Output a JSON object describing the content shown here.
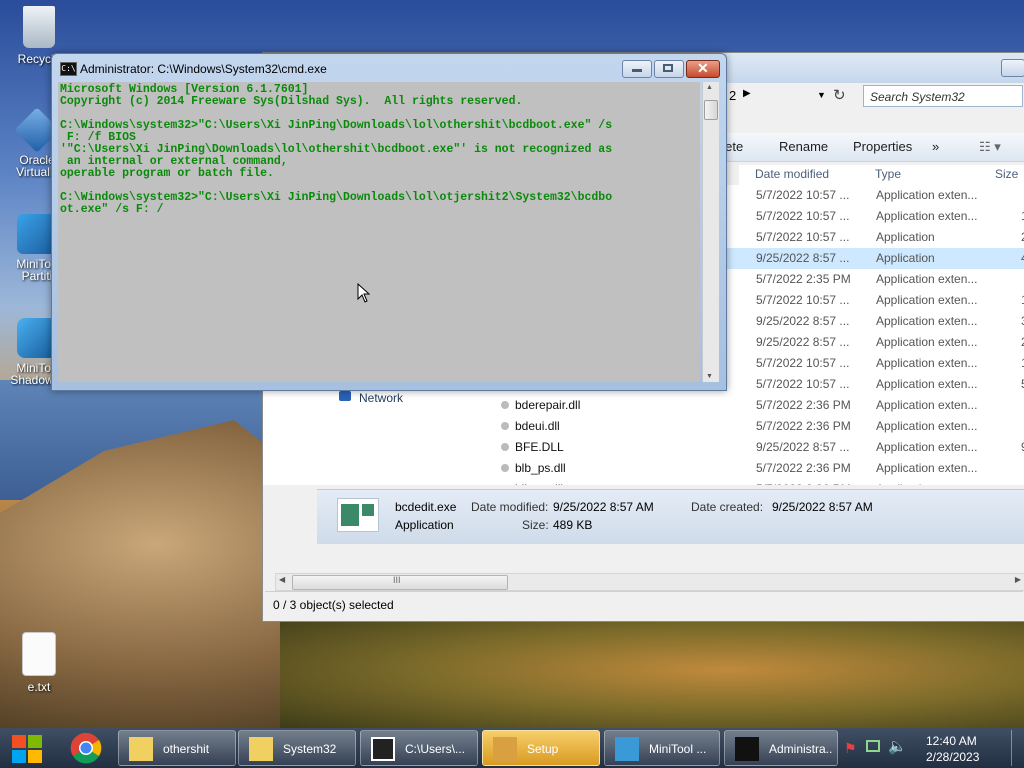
{
  "desktop": {
    "icons": [
      {
        "label": "Recycle",
        "id": "recycle"
      },
      {
        "label": "Oracle\nVirtualE",
        "id": "virtualbox"
      },
      {
        "label": "MiniToo\nPartiti",
        "id": "minitool-partition"
      },
      {
        "label": "MiniToo\nShadowM",
        "id": "minitool-shadowmaker"
      },
      {
        "label": "e.txt",
        "id": "etxt"
      }
    ]
  },
  "explorer": {
    "address_num": "2",
    "search_placeholder": "Search System32",
    "toolbar": {
      "delete": "elete",
      "rename": "Rename",
      "properties": "Properties",
      "more": "»"
    },
    "columns": {
      "date": "Date modified",
      "type": "Type",
      "size": "Size"
    },
    "nav_network": "Network",
    "files": [
      {
        "name": "",
        "date": "5/7/2022 10:57 ...",
        "type": "Application exten...",
        "size": "",
        "selected": false
      },
      {
        "name": "",
        "date": "5/7/2022 10:57 ...",
        "type": "Application exten...",
        "size": "1",
        "selected": false
      },
      {
        "name": "",
        "date": "5/7/2022 10:57 ...",
        "type": "Application",
        "size": "2",
        "selected": false
      },
      {
        "name": "",
        "date": "9/25/2022 8:57 ...",
        "type": "Application",
        "size": "4",
        "selected": true
      },
      {
        "name": "",
        "date": "5/7/2022 2:35 PM",
        "type": "Application exten...",
        "size": "",
        "selected": false
      },
      {
        "name": "",
        "date": "5/7/2022 10:57 ...",
        "type": "Application exten...",
        "size": "1",
        "selected": false
      },
      {
        "name": "",
        "date": "9/25/2022 8:57 ...",
        "type": "Application exten...",
        "size": "3",
        "selected": false
      },
      {
        "name": "",
        "date": "9/25/2022 8:57 ...",
        "type": "Application exten...",
        "size": "2",
        "selected": false
      },
      {
        "name": "",
        "date": "5/7/2022 10:57 ...",
        "type": "Application exten...",
        "size": "1",
        "selected": false
      },
      {
        "name": "",
        "date": "5/7/2022 10:57 ...",
        "type": "Application exten...",
        "size": "5",
        "selected": false
      },
      {
        "name": "bderepair.dll",
        "date": "5/7/2022 2:36 PM",
        "type": "Application exten...",
        "size": "",
        "selected": false
      },
      {
        "name": "bdeui.dll",
        "date": "5/7/2022 2:36 PM",
        "type": "Application exten...",
        "size": "",
        "selected": false
      },
      {
        "name": "BFE.DLL",
        "date": "9/25/2022 8:57 ...",
        "type": "Application exten...",
        "size": "9",
        "selected": false
      },
      {
        "name": "blb_ps.dll",
        "date": "5/7/2022 2:36 PM",
        "type": "Application exten...",
        "size": "",
        "selected": false
      },
      {
        "name": "blbres.dll",
        "date": "5/7/2022 2:36 PM",
        "type": "Application exten...",
        "size": "",
        "selected": false
      }
    ],
    "details": {
      "filename": "bcdedit.exe",
      "date_modified_label": "Date modified:",
      "date_modified": "9/25/2022 8:57 AM",
      "date_created_label": "Date created:",
      "date_created": "9/25/2022 8:57 AM",
      "type": "Application",
      "size_label": "Size:",
      "size": "489 KB"
    },
    "scroll_glyph": "III",
    "status": "0 / 3 object(s) selected"
  },
  "cmd": {
    "title": "Administrator: C:\\Windows\\System32\\cmd.exe",
    "icon_text": "C:\\",
    "lines": [
      "Microsoft Windows [Version 6.1.7601]",
      "Copyright (c) 2014 Freeware Sys(Dilshad Sys).  All rights reserved.",
      "",
      "C:\\Windows\\system32>\"C:\\Users\\Xi JinPing\\Downloads\\lol\\othershit\\bcdboot.exe\" /s",
      " F: /f BIOS",
      "'\"C:\\Users\\Xi JinPing\\Downloads\\lol\\othershit\\bcdboot.exe\"' is not recognized as",
      " an internal or external command,",
      "operable program or batch file.",
      "",
      "C:\\Windows\\system32>\"C:\\Users\\Xi JinPing\\Downloads\\lol\\otjershit2\\System32\\bcdbo",
      "ot.exe\" /s F: /"
    ]
  },
  "taskbar": {
    "buttons": [
      {
        "label": "othershit",
        "id": "othershit"
      },
      {
        "label": "System32",
        "id": "system32"
      },
      {
        "label": "C:\\Users\\...",
        "id": "7zip"
      },
      {
        "label": "Setup",
        "id": "setup"
      },
      {
        "label": "MiniTool ...",
        "id": "minitool"
      },
      {
        "label": "Administra...",
        "id": "cmd"
      }
    ],
    "time": "12:40 AM",
    "date": "2/28/2023"
  }
}
